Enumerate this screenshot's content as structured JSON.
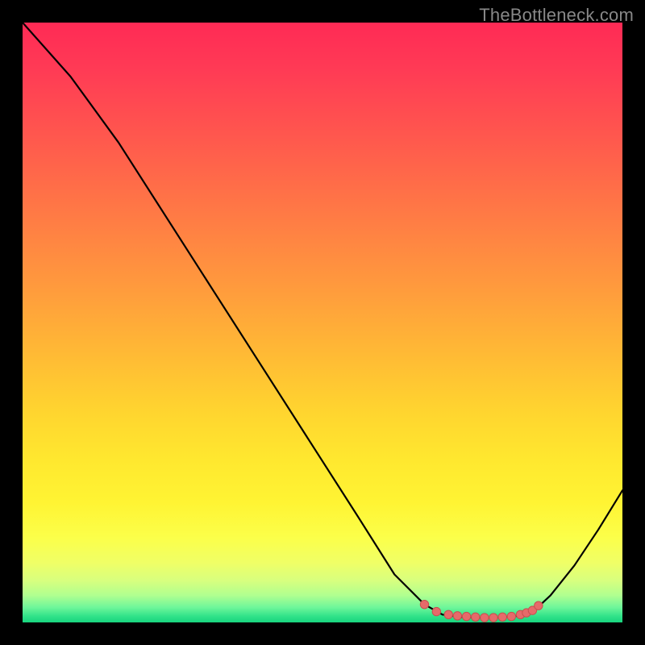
{
  "watermark": "TheBottleneck.com",
  "chart_data": {
    "type": "line",
    "title": "",
    "xlabel": "",
    "ylabel": "",
    "xlim": [
      0,
      100
    ],
    "ylim": [
      0,
      100
    ],
    "series": [
      {
        "name": "curve",
        "x": [
          0,
          8,
          16,
          24,
          32,
          40,
          48,
          56,
          62,
          67,
          70,
          73,
          76,
          79,
          82,
          85,
          88,
          92,
          96,
          100
        ],
        "y": [
          100,
          91,
          80,
          67.5,
          55,
          42.5,
          30,
          17.5,
          8,
          3,
          1.3,
          0.9,
          0.8,
          0.8,
          1.0,
          1.7,
          4.5,
          9.5,
          15.5,
          22
        ]
      }
    ],
    "markers": {
      "name": "highlight",
      "x": [
        67,
        69,
        71,
        72.5,
        74,
        75.5,
        77,
        78.5,
        80,
        81.5,
        83,
        84,
        85,
        86
      ],
      "y": [
        3.0,
        1.8,
        1.3,
        1.1,
        1.0,
        0.9,
        0.8,
        0.8,
        0.9,
        1.0,
        1.3,
        1.6,
        2.0,
        2.8
      ]
    },
    "colors": {
      "curve": "#000000",
      "marker": "#e66a6a",
      "marker_stroke": "#c94f4f"
    }
  }
}
